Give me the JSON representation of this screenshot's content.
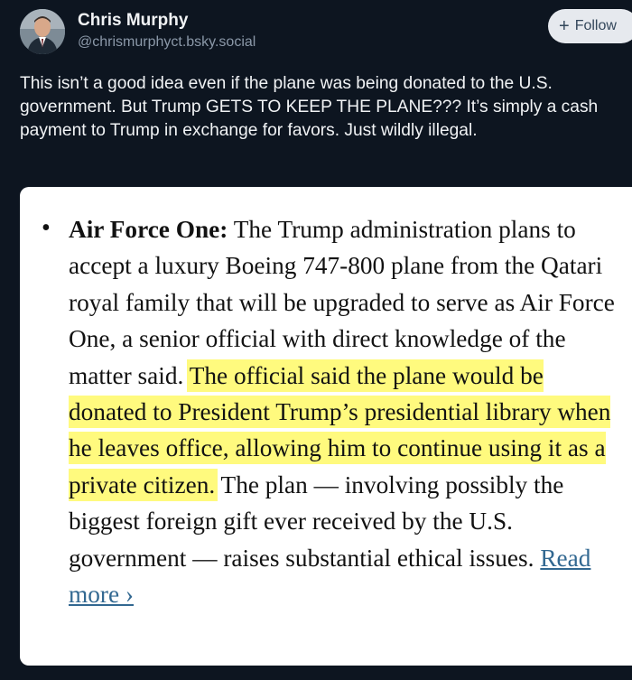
{
  "author": {
    "display_name": "Chris Murphy",
    "handle": "@chrismurphyct.bsky.social"
  },
  "follow_button": {
    "icon": "+",
    "label": "Follow"
  },
  "post": {
    "text": "This isn’t a good idea even if the plane was being donated to the U.S. government. But Trump GETS TO KEEP THE PLANE??? It’s simply a cash payment to Trump in exchange for favors. Just wildly illegal."
  },
  "embed": {
    "bullet": "•",
    "heading": "Air Force One:",
    "body_before": " The Trump administration plans to accept a luxury Boeing 747-800 plane from the Qatari royal family that will be upgraded to serve as Air Force One, a senior official with direct knowledge of the matter said. ",
    "highlighted": "The official said the plane would be donated to President Trump’s presidential library when he leaves office, allowing him to continue using it as a private citizen.",
    "body_after": " The plan — involving possibly the biggest foreign gift ever received by the U.S. government — raises substantial ethical issues. ",
    "read_more": "Read more ›"
  },
  "colors": {
    "background": "#0d1520",
    "text": "#f1f3f5",
    "handle": "#8b98a8",
    "follow_bg": "#e6e9ee",
    "highlight": "#fff95a",
    "link": "#326891"
  }
}
